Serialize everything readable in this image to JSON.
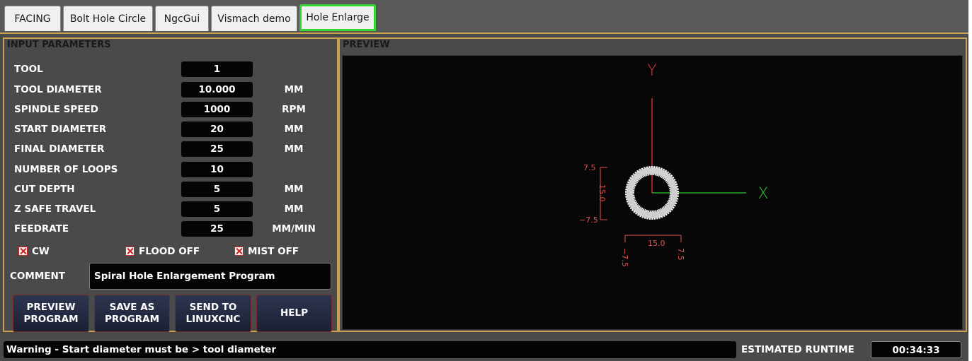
{
  "tabs": [
    {
      "label": "FACING",
      "active": false
    },
    {
      "label": "Bolt Hole Circle",
      "active": false
    },
    {
      "label": "NgcGui",
      "active": false
    },
    {
      "label": "Vismach demo",
      "active": false
    },
    {
      "label": "Hole Enlarge",
      "active": true
    }
  ],
  "input_panel": {
    "title": "INPUT PARAMETERS",
    "params": [
      {
        "label": "TOOL",
        "value": "1",
        "unit": ""
      },
      {
        "label": "TOOL DIAMETER",
        "value": "10.000",
        "unit": "MM"
      },
      {
        "label": "SPINDLE SPEED",
        "value": "1000",
        "unit": "RPM"
      },
      {
        "label": "START DIAMETER",
        "value": "20",
        "unit": "MM"
      },
      {
        "label": "FINAL DIAMETER",
        "value": "25",
        "unit": "MM"
      },
      {
        "label": "NUMBER OF LOOPS",
        "value": "10",
        "unit": ""
      },
      {
        "label": "CUT DEPTH",
        "value": "5",
        "unit": "MM"
      },
      {
        "label": "Z SAFE TRAVEL",
        "value": "5",
        "unit": "MM"
      },
      {
        "label": "FEEDRATE",
        "value": "25",
        "unit": "MM/MIN"
      }
    ],
    "checkboxes": {
      "cw": {
        "label": "CW",
        "checked": true
      },
      "flood": {
        "label": "FLOOD OFF",
        "checked": true
      },
      "mist": {
        "label": "MIST OFF",
        "checked": true
      }
    },
    "comment": {
      "label": "COMMENT",
      "value": "Spiral Hole Enlargement Program"
    },
    "buttons": {
      "preview": "PREVIEW\nPROGRAM",
      "save": "SAVE AS\nPROGRAM",
      "send": "SEND TO\nLINUXCNC",
      "help": "HELP"
    }
  },
  "preview_panel": {
    "title": "PREVIEW",
    "axes": {
      "x_label": "X",
      "y_label": "Y"
    },
    "dimensions": {
      "height_text": "15.0",
      "y_top": "7.5",
      "y_bottom": "−7.5",
      "width_text": "15.0",
      "x_left": "−7.5",
      "x_right": "7.5"
    },
    "colors": {
      "y_axis": "#e23b3b",
      "x_axis": "#33c433",
      "dims": "#e05050",
      "path": "#ffffff"
    }
  },
  "status": {
    "warning": "Warning - Start diameter must be > tool diameter",
    "runtime_label": "ESTIMATED RUNTIME",
    "runtime_value": "00:34:33"
  }
}
